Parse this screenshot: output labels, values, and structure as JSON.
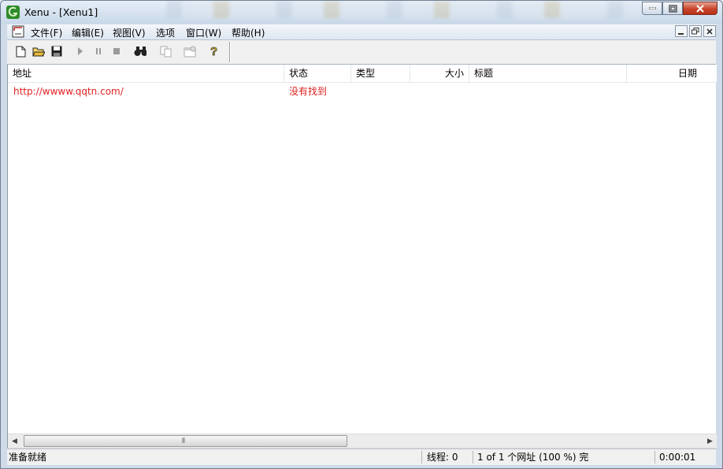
{
  "window": {
    "title": "Xenu - [Xenu1]"
  },
  "menu": {
    "items": [
      "文件(F)",
      "编辑(E)",
      "视图(V)",
      "选项",
      "窗口(W)",
      "帮助(H)"
    ]
  },
  "toolbar": {
    "buttons": [
      "new-icon",
      "open-icon",
      "save-icon",
      "play-icon",
      "pause-icon",
      "stop-icon",
      "find-icon",
      "copy-icon",
      "properties-icon",
      "help-icon"
    ]
  },
  "table": {
    "columns": [
      "地址",
      "状态",
      "类型",
      "大小",
      "标题",
      "日期"
    ],
    "rows": [
      {
        "address": "http://wwww.qqtn.com/",
        "status": "没有找到",
        "type": "",
        "size": "",
        "title": "",
        "date": ""
      }
    ]
  },
  "scrollbar": {
    "grip": "⦀"
  },
  "status": {
    "ready": "准备就绪",
    "threads": "线程: 0",
    "progress": "1 of 1 个网址 (100 %) 完",
    "time": "0:00:01"
  },
  "colors": {
    "error_text": "#e02020",
    "title_bar": "#c9d8e8"
  }
}
